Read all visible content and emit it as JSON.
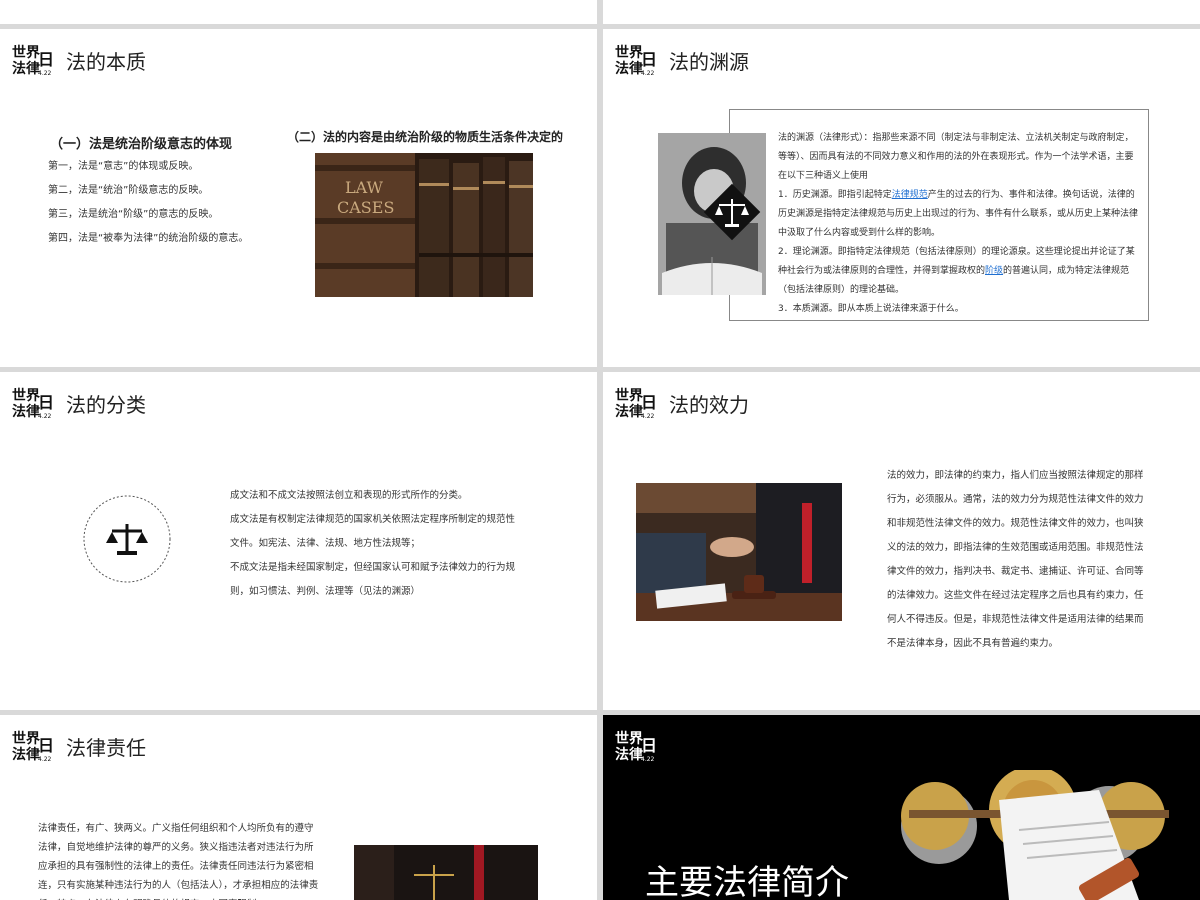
{
  "slides": [
    {
      "id": "s1",
      "title": "法的本质",
      "col1_heading": "（一）法是统治阶级意志的体现",
      "col1_lines": [
        "第一，法是“意志”的体现或反映。",
        "第二，法是“统治”阶级意志的反映。",
        "第三，法是统治“阶级”的意志的反映。",
        "第四，法是“被奉为法律”的统治阶级的意志。"
      ],
      "col2_heading": "（二）法的内容是由统治阶级的物质生活条件决定的",
      "book_label": "LAW\nCASES"
    },
    {
      "id": "s2",
      "title": "法的渊源",
      "p1": "法的渊源（法律形式）：指那些来源不同（制定法与非制定法、立法机关制定与政府制定，等等）、因而具有法的不同效力意义和作用的法的外在表现形式。作为一个法学术语，主要在以下三种语义上使用",
      "p2_a": "1．历史渊源。即指引起特定",
      "p2_link": "法律规范",
      "p2_b": "产生的过去的行为、事件和法律。换句话说，法律的历史渊源是指特定法律规范与历史上出现过的行为、事件有什么联系，或从历史上某种法律中汲取了什么内容或受到什么样的影响。",
      "p3_a": "2．理论渊源。即指特定法律规范（包括法律原则）的理论源泉。这些理论提出并论证了某种社会行为或法律原则的合理性，并得到掌握政权的",
      "p3_link": "阶级",
      "p3_b": "的普遍认同，成为特定法律规范（包括法律原则）的理论基础。",
      "p4": "3．本质渊源。即从本质上说法律来源于什么。"
    },
    {
      "id": "s3",
      "title": "法的分类",
      "lines": [
        "成文法和不成文法按照法创立和表现的形式所作的分类。",
        "成文法是有权制定法律规范的国家机关依照法定程序所制定的规范性文件。如宪法、法律、法规、地方性法规等；",
        "不成文法是指未经国家制定，但经国家认可和赋予法律效力的行为规则，如习惯法、判例、法理等（见法的渊源）"
      ]
    },
    {
      "id": "s4",
      "title": "法的效力",
      "body": "法的效力，即法律的约束力，指人们应当按照法律规定的那样行为，必须服从。通常，法的效力分为规范性法律文件的效力和非规范性法律文件的效力。规范性法律文件的效力，也叫狭义的法的效力，即指法律的生效范围或适用范围。非规范性法律文件的效力，指判决书、裁定书、逮捕证、许可证、合同等的法律效力。这些文件在经过法定程序之后也具有约束力，任何人不得违反。但是，非规范性法律文件是适用法律的结果而不是法律本身，因此不具有普遍约束力。"
    },
    {
      "id": "s5",
      "title": "法律责任",
      "body": "法律责任，有广、狭两义。广义指任何组织和个人均所负有的遵守法律，自觉地维护法律的尊严的义务。狭义指违法者对违法行为所应承担的具有强制性的法律上的责任。法律责任同违法行为紧密相连，只有实施某种违法行为的人（包括法人），才承担相应的法律责任。特点：在法律上有明确具体的规定；由国家强制"
    },
    {
      "id": "s6",
      "title": "主要法律简介"
    }
  ],
  "colors": {
    "bg": "#d9d9d9",
    "dark": "#000000",
    "gold": "#c9a24a",
    "link": "#1f6fd1"
  }
}
